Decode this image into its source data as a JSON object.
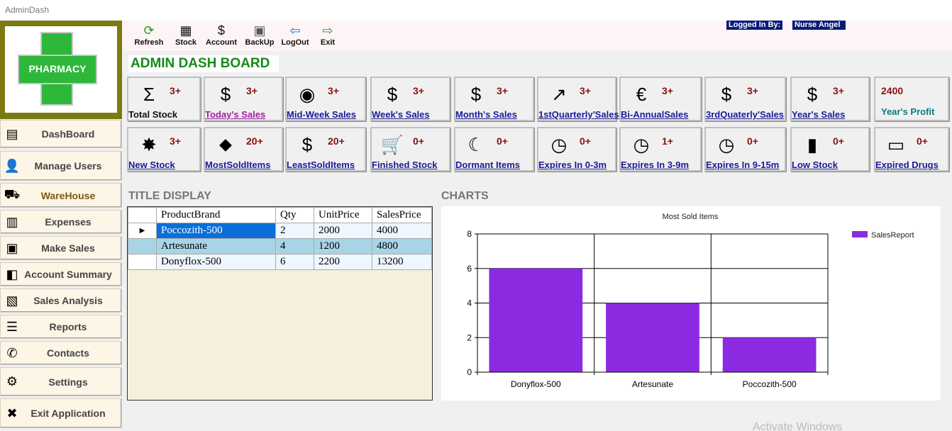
{
  "window": {
    "title": "AdminDash"
  },
  "logo": {
    "text": "PHARMACY"
  },
  "toolbar": [
    {
      "label": "Refresh",
      "icon": "refresh-icon",
      "glyph": "⟳",
      "color": "#2a9a2a"
    },
    {
      "label": "Stock",
      "icon": "stock-icon",
      "glyph": "▦",
      "color": "#111"
    },
    {
      "label": "Account",
      "icon": "account-icon",
      "glyph": "$",
      "color": "#111"
    },
    {
      "label": "BackUp",
      "icon": "backup-icon",
      "glyph": "▣",
      "color": "#555"
    },
    {
      "label": "LogOut",
      "icon": "logout-icon",
      "glyph": "⇦",
      "color": "#0a7ad8"
    },
    {
      "label": "Exit",
      "icon": "exit-icon",
      "glyph": "⇨",
      "color": "#2a9a2a"
    }
  ],
  "login": {
    "label": "Logged In By:",
    "user": "Nurse Angel"
  },
  "dashboard_title": "ADMIN DASH BOARD",
  "sidebar": [
    {
      "label": "DashBoard",
      "icon": "dashboard-icon",
      "glyph": "▤",
      "active": false
    },
    {
      "label": "Manage Users",
      "icon": "users-icon",
      "glyph": "👤",
      "active": false
    },
    {
      "label": "WareHouse",
      "icon": "warehouse-icon",
      "glyph": "⛟",
      "active": true
    },
    {
      "label": "Expenses",
      "icon": "expenses-icon",
      "glyph": "▥",
      "active": false
    },
    {
      "label": "Make Sales",
      "icon": "sales-icon",
      "glyph": "▣",
      "active": false
    },
    {
      "label": "Account Summary",
      "icon": "account-summary-icon",
      "glyph": "◧",
      "active": false
    },
    {
      "label": "Sales Analysis",
      "icon": "analysis-icon",
      "glyph": "▧",
      "active": false
    },
    {
      "label": "Reports",
      "icon": "reports-icon",
      "glyph": "☰",
      "active": false
    },
    {
      "label": "Contacts",
      "icon": "phone-icon",
      "glyph": "✆",
      "active": false
    },
    {
      "label": "Settings",
      "icon": "gear-icon",
      "glyph": "⚙",
      "active": false
    },
    {
      "label": "Exit Application",
      "icon": "exit-app-icon",
      "glyph": "✖",
      "active": false
    }
  ],
  "cards_row1": [
    {
      "label": "Total Stock",
      "value": "3+",
      "icon": "sigma-icon",
      "glyph": "Σ",
      "color": "#111",
      "link": false
    },
    {
      "label": "Today's  Sales",
      "value": "3+",
      "icon": "money-hand-icon",
      "glyph": "$",
      "color": "#a020a0",
      "link": true
    },
    {
      "label": "Mid-Week  Sales",
      "value": "3+",
      "icon": "sales-globe-icon",
      "glyph": "◉",
      "color": "#1a1a9a",
      "link": true
    },
    {
      "label": "Week's Sales",
      "value": "3+",
      "icon": "money-bag-icon",
      "glyph": "$",
      "color": "#1a1a9a",
      "link": true
    },
    {
      "label": "Month's Sales",
      "value": "3+",
      "icon": "banknote-icon",
      "glyph": "$",
      "color": "#1a1a9a",
      "link": true
    },
    {
      "label": "1stQuarterly'Sales",
      "value": "3+",
      "icon": "growth-chart-icon",
      "glyph": "↗",
      "color": "#1a1a9a",
      "link": true
    },
    {
      "label": "Bi-AnnualSales",
      "value": "3+",
      "icon": "currency-symbols-icon",
      "glyph": "€",
      "color": "#1a1a9a",
      "link": true
    },
    {
      "label": "3rdQuaterly'Sales",
      "value": "3+",
      "icon": "coin-stack-icon",
      "glyph": "$",
      "color": "#1a1a9a",
      "link": true
    },
    {
      "label": "Year's Sales",
      "value": "3+",
      "icon": "dollar-circle-icon",
      "glyph": "$",
      "color": "#1a1a9a",
      "link": true
    },
    {
      "label": "Year's Profit",
      "value": "2400",
      "icon": "",
      "glyph": "",
      "color": "#0a7a7a",
      "link": false
    }
  ],
  "cards_row2": [
    {
      "label": "New Stock",
      "value": "3+",
      "icon": "new-product-icon",
      "glyph": "✸",
      "color": "#1a1a9a",
      "link": true
    },
    {
      "label": "MostSoldItems",
      "value": "20+",
      "icon": "sale-tag-icon",
      "glyph": "⬥",
      "color": "#1a1a9a",
      "link": true
    },
    {
      "label": "LeastSoldItems",
      "value": "20+",
      "icon": "dollar-down-icon",
      "glyph": "$",
      "color": "#1a1a9a",
      "link": true
    },
    {
      "label": "Finished Stock",
      "value": "0+",
      "icon": "cart-icon",
      "glyph": "🛒",
      "color": "#1a1a9a",
      "link": true
    },
    {
      "label": "Dormant Items",
      "value": "0+",
      "icon": "moon-icon",
      "glyph": "☾",
      "color": "#1a1a9a",
      "link": true
    },
    {
      "label": "Expires In 0-3m",
      "value": "0+",
      "icon": "clock-icon",
      "glyph": "◷",
      "color": "#1a1a9a",
      "link": true
    },
    {
      "label": "Expires In 3-9m",
      "value": "1+",
      "icon": "clock-icon",
      "glyph": "◷",
      "color": "#1a1a9a",
      "link": true
    },
    {
      "label": "Expires In 9-15m",
      "value": "0+",
      "icon": "clock-icon",
      "glyph": "◷",
      "color": "#1a1a9a",
      "link": true
    },
    {
      "label": "Low Stock",
      "value": "0+",
      "icon": "low-stock-icon",
      "glyph": "▮",
      "color": "#1a1a9a",
      "link": true
    },
    {
      "label": "Expired Drugs",
      "value": "0+",
      "icon": "expired-stamp-icon",
      "glyph": "▭",
      "color": "#1a1a9a",
      "link": true
    }
  ],
  "table": {
    "section_title": "TITLE DISPLAY",
    "headers": [
      "ProductBrand",
      "Qty",
      "UnitPrice",
      "SalesPrice"
    ],
    "rows": [
      [
        "Poccozith-500",
        "2",
        "2000",
        "4000"
      ],
      [
        "Artesunate",
        "4",
        "1200",
        "4800"
      ],
      [
        "Donyflox-500",
        "6",
        "2200",
        "13200"
      ]
    ]
  },
  "charts_title": "CHARTS",
  "chart_data": {
    "type": "bar",
    "title": "Most Sold Items",
    "categories": [
      "Donyflox-500",
      "Artesunate",
      "Poccozith-500"
    ],
    "series": [
      {
        "name": "SalesReport",
        "values": [
          6,
          4,
          2
        ],
        "color": "#8a2be2"
      }
    ],
    "ylim": [
      0,
      8
    ],
    "yticks": [
      "0",
      "2",
      "4",
      "6",
      "8"
    ],
    "grid": true,
    "legend_position": "top-right"
  },
  "watermark": "Activate Windows"
}
